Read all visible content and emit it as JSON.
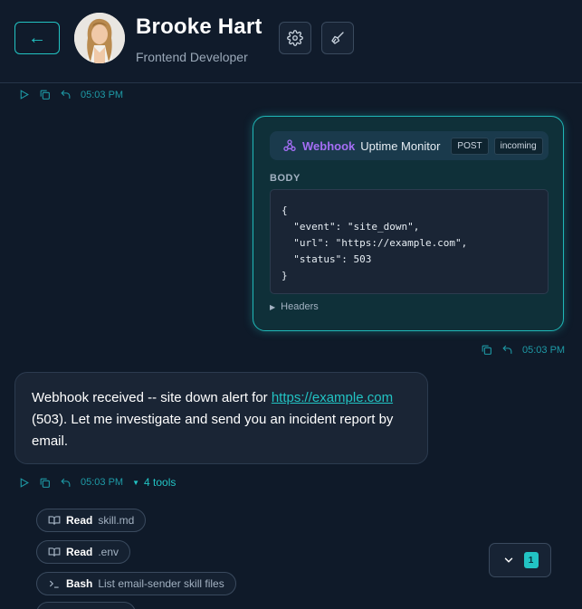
{
  "header": {
    "back_glyph": "←",
    "name": "Brooke Hart",
    "role": "Frontend Developer",
    "settings_icon": "gear-icon",
    "clear_icon": "broom-icon"
  },
  "messages": {
    "first_meta": {
      "time": "05:03 PM"
    },
    "webhook": {
      "brand": "Webhook",
      "name": "Uptime Monitor",
      "method": "POST",
      "direction": "incoming",
      "body_label": "BODY",
      "body": "{\n  \"event\": \"site_down\",\n  \"url\": \"https://example.com\",\n  \"status\": 503\n}",
      "headers_label": "Headers",
      "time": "05:03 PM"
    },
    "reply": {
      "text_before": "Webhook received -- site down alert for ",
      "link": "https://example.com",
      "text_after": " (503). Let me investigate and send you an incident report by email.",
      "time": "05:03 PM",
      "tools_label": "4 tools"
    }
  },
  "tools": [
    {
      "name": "Read",
      "arg": "skill.md",
      "icon": "book-icon"
    },
    {
      "name": "Read",
      "arg": ".env",
      "icon": "book-icon"
    },
    {
      "name": "Bash",
      "arg": "List email-sender skill files",
      "icon": "terminal-icon"
    }
  ],
  "scroll": {
    "badge": "1"
  },
  "colors": {
    "accent": "#22c3c3",
    "webhook_brand": "#a56ef5",
    "background": "#0f1a29"
  }
}
